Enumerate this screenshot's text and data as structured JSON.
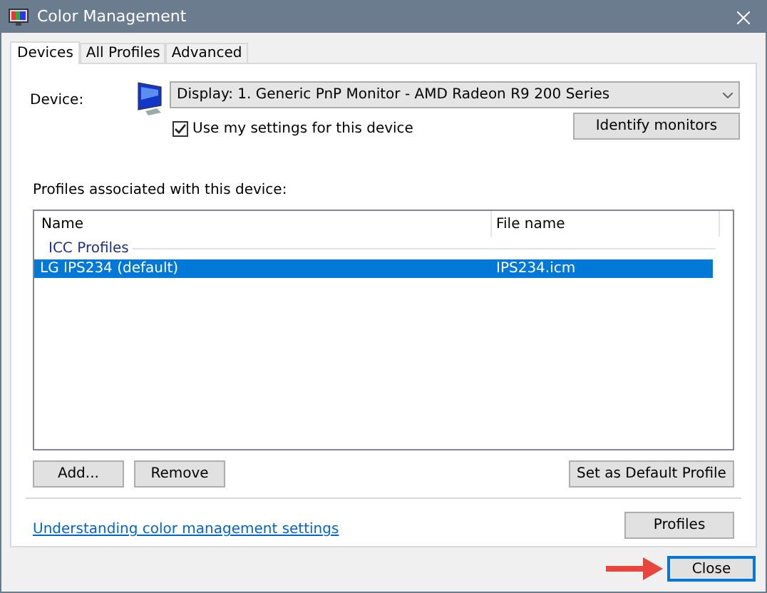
{
  "window": {
    "title": "Color Management"
  },
  "tabs": [
    {
      "label": "Devices",
      "selected": true
    },
    {
      "label": "All Profiles",
      "selected": false
    },
    {
      "label": "Advanced",
      "selected": false
    }
  ],
  "device": {
    "label": "Device:",
    "value": "Display: 1. Generic PnP Monitor - AMD Radeon R9 200 Series"
  },
  "use_my_settings": {
    "label": "Use my settings for this device",
    "checked": true
  },
  "identify_button": "Identify monitors",
  "profiles_label": "Profiles associated with this device:",
  "table": {
    "columns": [
      "Name",
      "File name"
    ],
    "group": "ICC Profiles",
    "rows": [
      {
        "name": "LG IPS234 (default)",
        "file": "IPS234.icm",
        "selected": true
      }
    ]
  },
  "buttons": [
    "Add...",
    "Remove",
    "Set as Default Profile"
  ],
  "link": "Understanding color management settings",
  "profiles_button": "Profiles",
  "close_button": "Close"
}
